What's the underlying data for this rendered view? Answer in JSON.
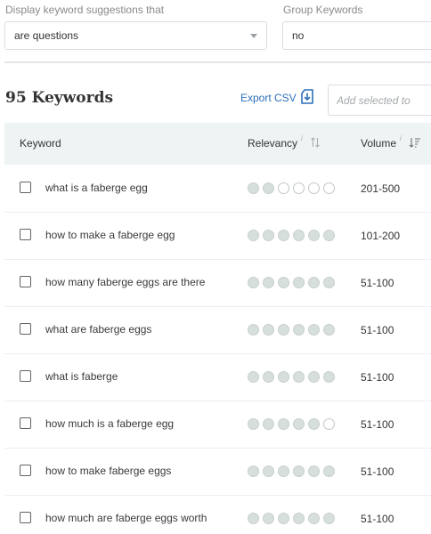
{
  "filters": {
    "suggestions_label": "Display keyword suggestions that",
    "suggestions_value": "are questions",
    "group_label": "Group Keywords",
    "group_value": "no"
  },
  "toolbar": {
    "count_title": "95 Keywords",
    "export_label": "Export CSV",
    "add_placeholder": "Add selected to"
  },
  "table": {
    "columns": {
      "keyword": "Keyword",
      "relevancy": "Relevancy",
      "volume": "Volume",
      "info_glyph": "i"
    },
    "rows": [
      {
        "keyword": "what is a faberge egg",
        "relevancy": 2,
        "volume": "201-500"
      },
      {
        "keyword": "how to make a faberge egg",
        "relevancy": 6,
        "volume": "101-200"
      },
      {
        "keyword": "how many faberge eggs are there",
        "relevancy": 6,
        "volume": "51-100"
      },
      {
        "keyword": "what are faberge eggs",
        "relevancy": 6,
        "volume": "51-100"
      },
      {
        "keyword": "what is faberge",
        "relevancy": 6,
        "volume": "51-100"
      },
      {
        "keyword": "how much is a faberge egg",
        "relevancy": 5,
        "volume": "51-100"
      },
      {
        "keyword": "how to make faberge eggs",
        "relevancy": 6,
        "volume": "51-100"
      },
      {
        "keyword": "how much are faberge eggs worth",
        "relevancy": 6,
        "volume": "51-100"
      }
    ],
    "relevancy_max": 6
  },
  "colors": {
    "link": "#2c6fb8",
    "header_bg": "#eef4f4",
    "dot_filled": "#d7dfdd"
  }
}
